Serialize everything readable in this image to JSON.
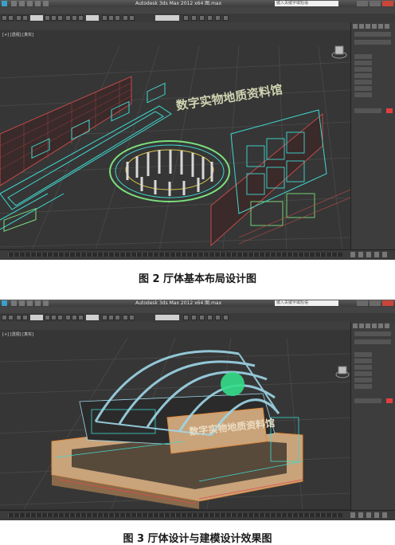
{
  "screenshot1": {
    "window_title": "Autodesk 3ds Max 2012 x64    图.max",
    "search_placeholder": "键入关键字或短语",
    "viewport_label": "[+] [透视] [真实]",
    "sign_text": "数字实物地质资料馆",
    "caption": "图 2  厅体基本布局设计图"
  },
  "screenshot2": {
    "window_title": "Autodesk 3ds Max 2012 x64    图.max",
    "search_placeholder": "键入关键字或短语",
    "viewport_label": "[+] [透视] [真实]",
    "sign_text": "数字实物地质资料馆",
    "caption": "图 3  厅体设计与建模设计效果图"
  },
  "colors": {
    "viewport_bg": "#363636",
    "grid": "#4a4a4a",
    "wire_cyan": "#3fd9d0",
    "wire_red": "#c24a4a",
    "wire_green": "#7be07b",
    "wood": "#c9a37a",
    "dome_green": "#33dd88"
  }
}
